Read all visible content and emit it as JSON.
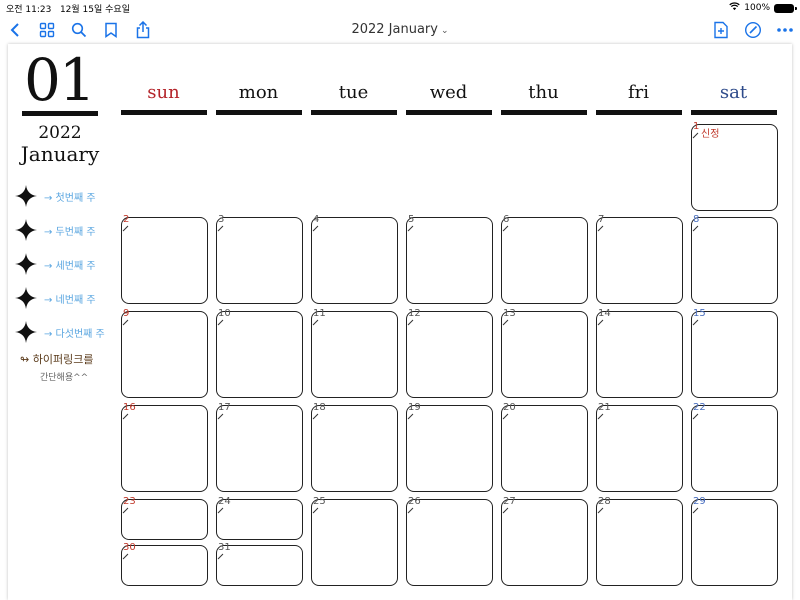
{
  "status_bar": {
    "time": "오전 11:23",
    "date": "12월 15일 수요일",
    "battery": "100%"
  },
  "toolbar": {
    "title": "2022 January"
  },
  "calendar": {
    "month_number": "01",
    "year": "2022",
    "month_name": "January",
    "weekdays": [
      "sun",
      "mon",
      "tue",
      "wed",
      "thu",
      "fri",
      "sat"
    ],
    "week_links": [
      "→ 첫번째 주",
      "→ 두번째 주",
      "→ 세번째 주",
      "→ 네번째 주",
      "→ 다섯번째 주"
    ],
    "note_line1": "하이퍼링크를",
    "note_line2": "간단해용^^",
    "holiday_label": "신정",
    "days": [
      "1",
      "2",
      "3",
      "4",
      "5",
      "6",
      "7",
      "8",
      "9",
      "10",
      "11",
      "12",
      "13",
      "14",
      "15",
      "16",
      "17",
      "18",
      "19",
      "20",
      "21",
      "22",
      "23",
      "24",
      "25",
      "26",
      "27",
      "28",
      "29",
      "30",
      "31"
    ]
  },
  "colors": {
    "sunday": "#b4242a",
    "saturday": "#2d4a8a",
    "link": "#5aa6e0",
    "toolbar_icon": "#1a73e8"
  }
}
